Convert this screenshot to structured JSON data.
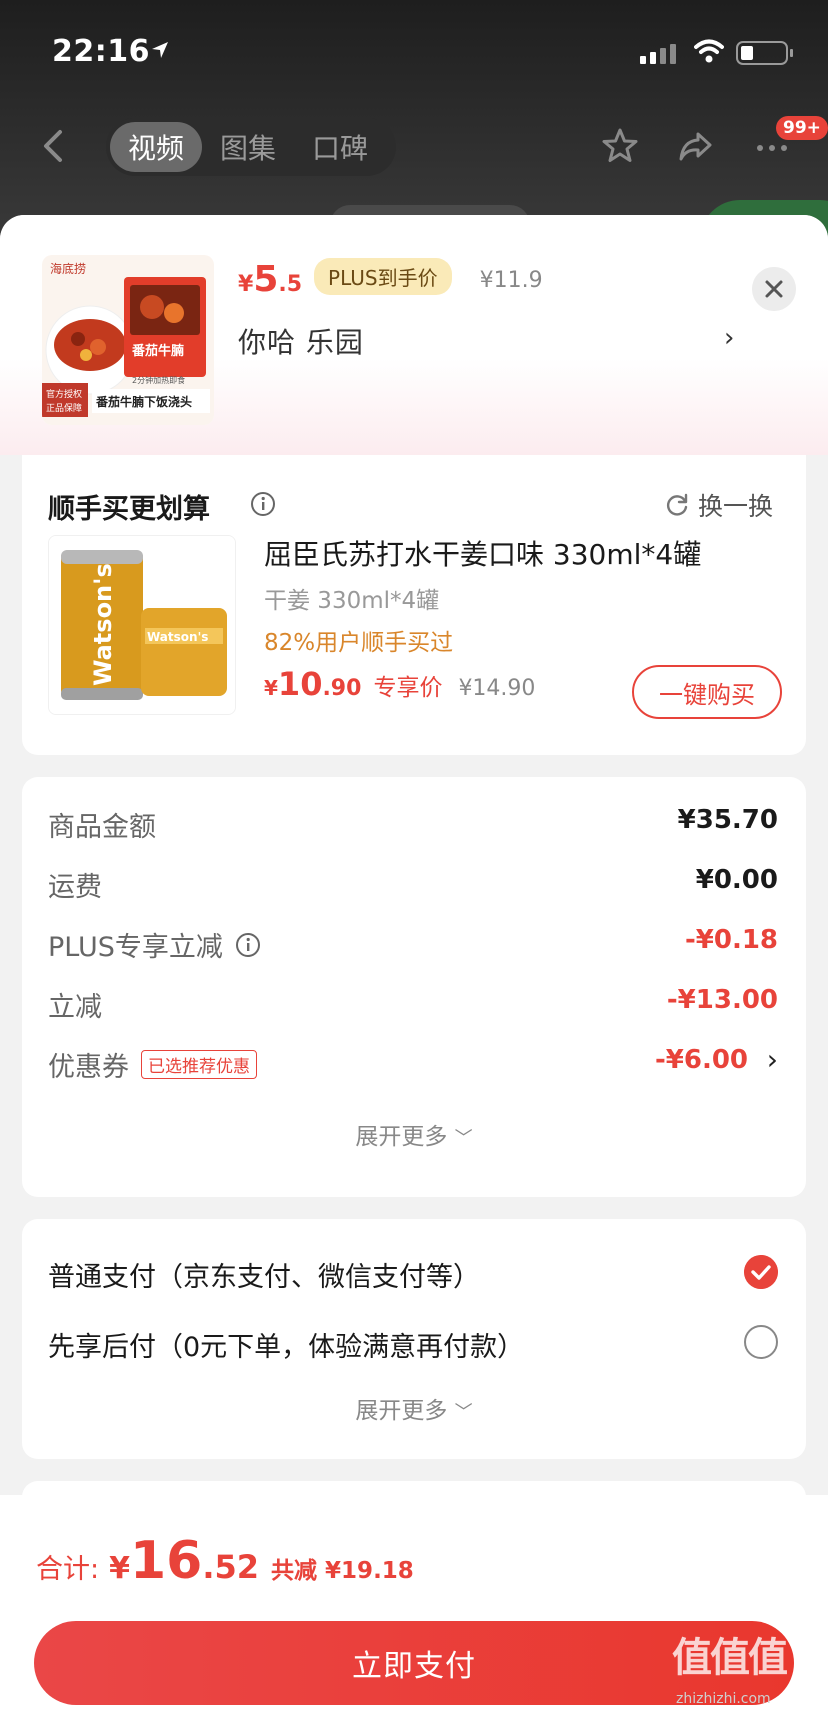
{
  "status": {
    "time": "22:16"
  },
  "nav": {
    "tabs": [
      "视频",
      "图集",
      "口碑"
    ],
    "active_tab": 0,
    "badge": "99+"
  },
  "product": {
    "price_yen": "¥",
    "price_int": "5",
    "price_dec": ".5",
    "plus_tag": "PLUS到手价",
    "original_price": "¥11.9",
    "variant": "你哈  乐园",
    "thumb_brand": "海底捞",
    "thumb_name": "番茄牛腩",
    "thumb_caption": "番茄牛腩下饭浇头",
    "thumb_sub": "2分钟加热即食",
    "thumb_badge_1": "官方授权",
    "thumb_badge_2": "正品保障"
  },
  "upsell": {
    "title": "顺手买更划算",
    "swap_label": "换一换",
    "name": "屈臣氏苏打水干姜口味 330ml*4罐",
    "spec": "干姜 330ml*4罐",
    "popularity": "82%用户顺手买过",
    "price_yen": "¥",
    "price_int": "10",
    "price_dec": ".90",
    "price_type": "专享价",
    "old_price": "¥14.90",
    "buy_label": "一键购买",
    "can_brand": "Watson's"
  },
  "summary": {
    "rows": [
      {
        "label": "商品金额",
        "value": "¥35.70"
      },
      {
        "label": "运费",
        "value": "¥0.00"
      },
      {
        "label": "PLUS专享立减",
        "value": "-¥0.18"
      },
      {
        "label": "立减",
        "value": "-¥13.00"
      },
      {
        "label": "优惠券",
        "value": "-¥6.00",
        "tag": "已选推荐优惠"
      }
    ],
    "expand_label": "展开更多"
  },
  "payment": {
    "options": [
      {
        "label": "普通支付（京东支付、微信支付等）",
        "selected": true
      },
      {
        "label": "先享后付（0元下单，体验满意再付款）",
        "selected": false
      }
    ],
    "expand_label": "展开更多"
  },
  "footer": {
    "total_label": "合计:",
    "total_yen": "¥",
    "total_int": "16",
    "total_dec": ".52",
    "savings": "共减 ¥19.18",
    "pay_label": "立即支付",
    "watermark": "值值值",
    "watermark_url": "zhizhizhi.com"
  },
  "colors": {
    "accent": "#e8433a",
    "plus_tag_bg": "#faeab8",
    "popularity": "#d9862b"
  }
}
